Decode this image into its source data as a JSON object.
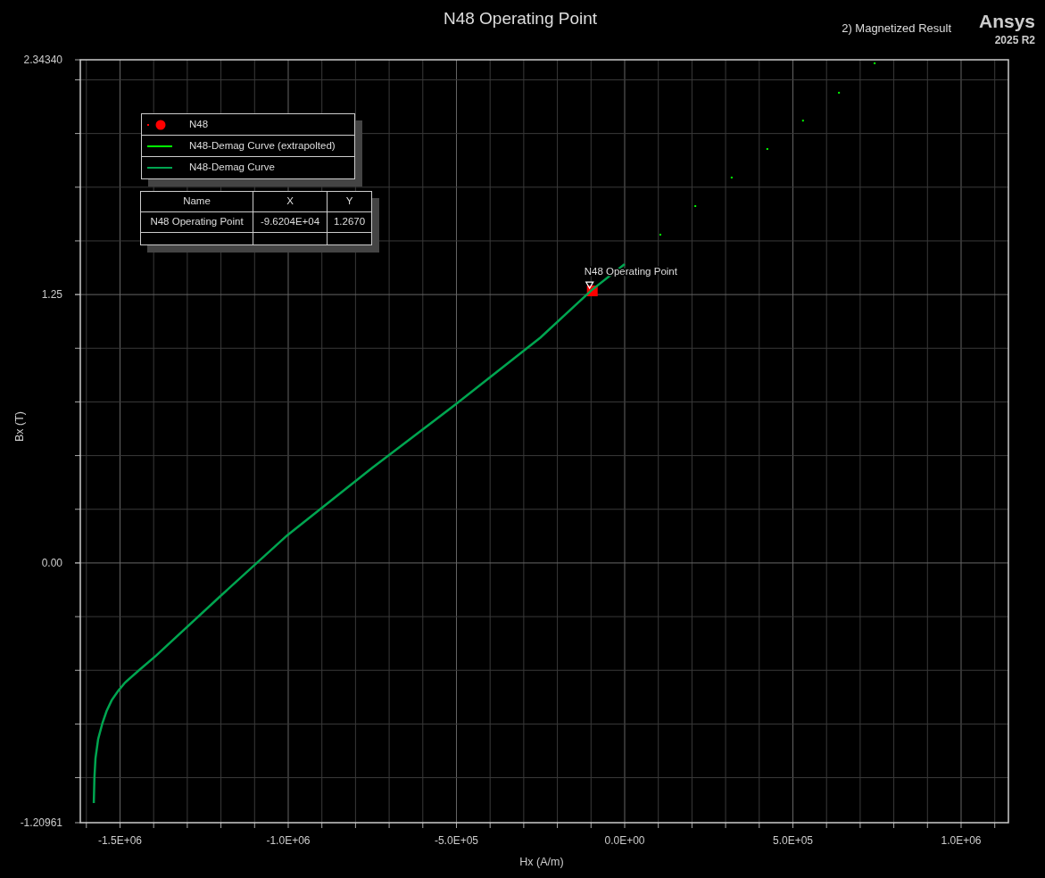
{
  "title": "N48 Operating Point",
  "subtitle": "2) Magnetized Result",
  "brand": {
    "name": "Ansys",
    "version": "2025 R2"
  },
  "chart_data": {
    "type": "line",
    "grid": true,
    "xlabel": "Hx (A/m)",
    "ylabel": "Bx (T)",
    "xlim": [
      -1618000,
      1140600
    ],
    "ylim": [
      -1.20961,
      2.3434
    ],
    "xticks": [
      {
        "value": -1500000,
        "label": "-1.5E+06"
      },
      {
        "value": -1000000,
        "label": "-1.0E+06"
      },
      {
        "value": -500000,
        "label": "-5.0E+05"
      },
      {
        "value": 0,
        "label": "0.0E+00"
      },
      {
        "value": 500000,
        "label": "5.0E+05"
      },
      {
        "value": 1000000,
        "label": "1.0E+06"
      }
    ],
    "yticks": [
      {
        "value": 2.3434,
        "label": "2.34340"
      },
      {
        "value": 1.25,
        "label": "1.25"
      },
      {
        "value": 0,
        "label": "0.00"
      },
      {
        "value": -1.20961,
        "label": "-1.20961"
      }
    ],
    "series": [
      {
        "name": "N48",
        "type": "scatter",
        "color": "#ff0000",
        "x": [
          -96204
        ],
        "values": [
          1.267
        ]
      },
      {
        "name": "N48-Demag Curve (extrapolted)",
        "type": "scatter",
        "color": "#00ff00",
        "x": [
          106000,
          210000,
          318000,
          424000,
          530000,
          637000,
          743000
        ],
        "values": [
          1.529,
          1.662,
          1.795,
          1.928,
          2.06,
          2.19,
          2.327
        ]
      },
      {
        "name": "N48-Demag Curve",
        "type": "line",
        "color": "#00a550",
        "x": [
          -1578000,
          -1576000,
          -1573000,
          -1565000,
          -1552000,
          -1540000,
          -1525000,
          -1505000,
          -1485000,
          -1440000,
          -1393000,
          -1200000,
          -1003000,
          -750000,
          -501000,
          -250000,
          -98000,
          0
        ],
        "values": [
          -1.118,
          -1.0,
          -0.91,
          -0.82,
          -0.744,
          -0.69,
          -0.64,
          -0.595,
          -0.557,
          -0.495,
          -0.432,
          -0.152,
          0.129,
          0.443,
          0.74,
          1.05,
          1.271,
          1.392
        ]
      }
    ],
    "annotations": [
      {
        "text": "N48 Operating Point"
      }
    ]
  },
  "marker_table": {
    "columns": [
      "Name",
      "X",
      "Y"
    ],
    "rows": [
      [
        "N48 Operating Point",
        "-9.6204E+04",
        "1.2670"
      ]
    ]
  }
}
